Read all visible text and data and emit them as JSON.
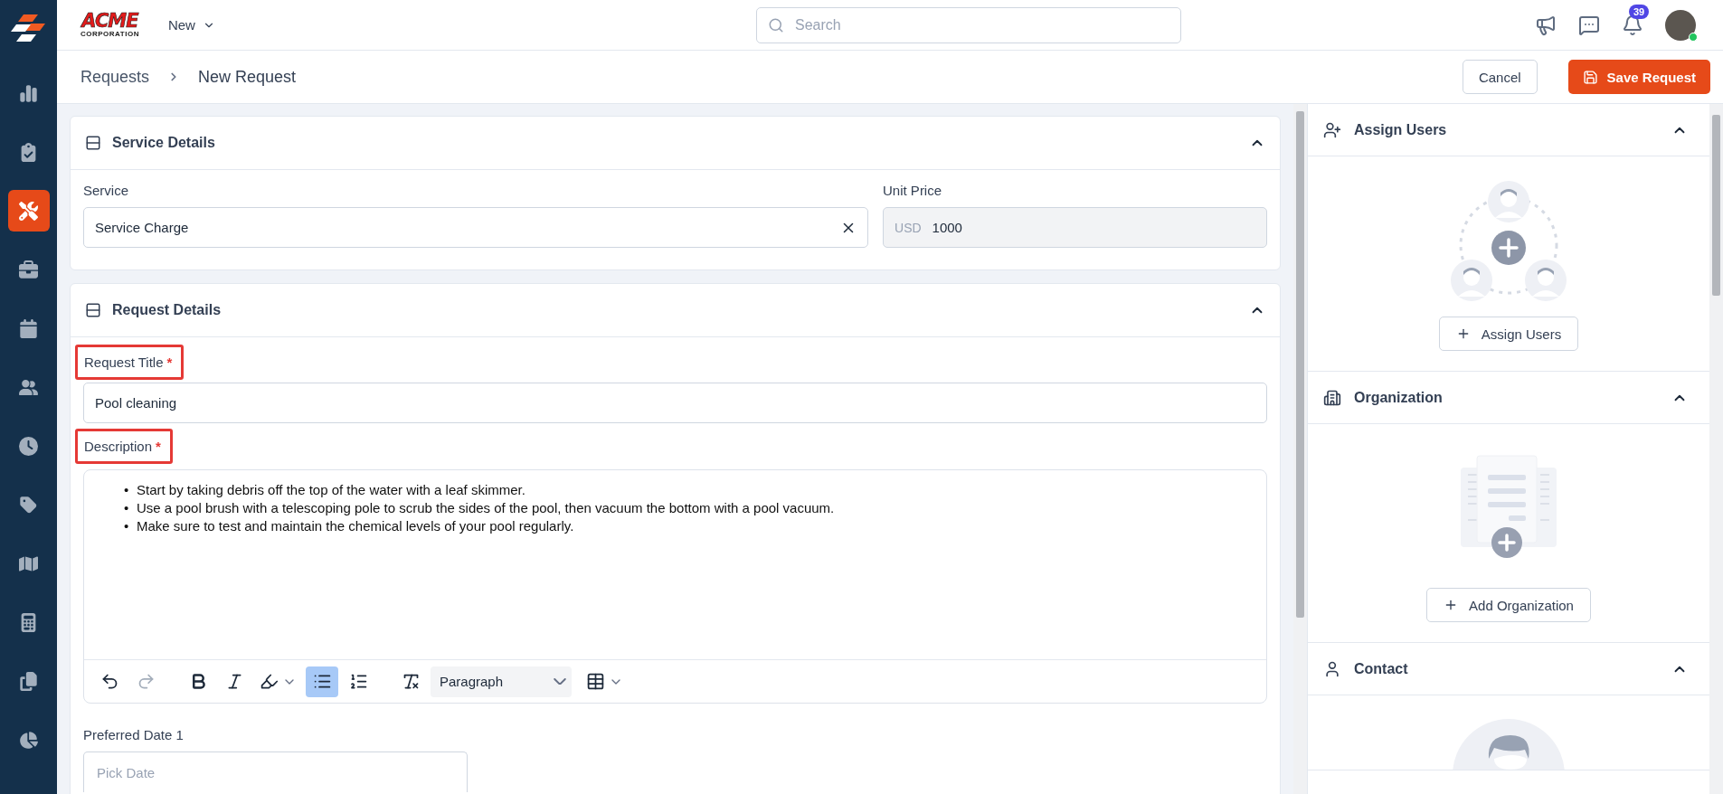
{
  "sidebar": {
    "items": [
      {
        "selected": false
      },
      {
        "selected": false
      },
      {
        "selected": true
      },
      {
        "selected": false
      },
      {
        "selected": false
      },
      {
        "selected": false
      },
      {
        "selected": false
      },
      {
        "selected": false
      },
      {
        "selected": false
      },
      {
        "selected": false
      },
      {
        "selected": false
      },
      {
        "selected": false
      }
    ]
  },
  "header": {
    "logo": {
      "name": "ACME",
      "tagline": "CORPORATION"
    },
    "new_menu": "New",
    "search": {
      "placeholder": "Search"
    },
    "notifications": {
      "count": "39"
    },
    "user": {
      "online": true
    }
  },
  "breadcrumb": [
    "Requests",
    "New Request"
  ],
  "actions": {
    "cancel": "Cancel",
    "save": "Save Request"
  },
  "service_details": {
    "title": "Service Details",
    "expanded": true,
    "service": {
      "label": "Service",
      "value": "Service Charge"
    },
    "unit_price": {
      "label": "Unit Price",
      "currency": "USD",
      "value": "1000"
    }
  },
  "request_details": {
    "title": "Request Details",
    "expanded": true,
    "request_title": {
      "label": "Request Title",
      "required_mark": "*",
      "highlighted": true,
      "value": "Pool cleaning"
    },
    "description": {
      "label": "Description",
      "required_mark": "*",
      "highlighted": true,
      "bullets": [
        {
          "marker": "•",
          "text": "Start by taking debris off the top of the water with a leaf skimmer."
        },
        {
          "marker": "•",
          "text": "Use a pool brush with a telescoping pole to scrub the sides of the pool, then vacuum the bottom with a pool vacuum."
        },
        {
          "marker": "•",
          "text": "Make sure to test and maintain the chemical levels of your pool regularly."
        }
      ],
      "toolbar": [
        {
          "kind": "undo",
          "disabled": false
        },
        {
          "kind": "redo",
          "disabled": true
        },
        {
          "kind": "bold",
          "selected": false
        },
        {
          "kind": "italic",
          "selected": false
        },
        {
          "kind": "highlight",
          "selected": false
        },
        {
          "kind": "bullet-list",
          "selected": true
        },
        {
          "kind": "numbered-list",
          "selected": false
        },
        {
          "kind": "clear-format",
          "selected": false
        },
        {
          "kind": "block-style",
          "value": "Paragraph"
        },
        {
          "kind": "table",
          "selected": false
        }
      ]
    },
    "preferred_date_1": {
      "label": "Preferred Date 1",
      "placeholder": "Pick Date"
    }
  },
  "side_panels": [
    {
      "kind": "assign-users",
      "title": "Assign Users",
      "expanded": true,
      "button": "Assign Users"
    },
    {
      "kind": "organization",
      "title": "Organization",
      "expanded": true,
      "button": "Add Organization"
    },
    {
      "kind": "contact",
      "title": "Contact",
      "expanded": true
    }
  ]
}
